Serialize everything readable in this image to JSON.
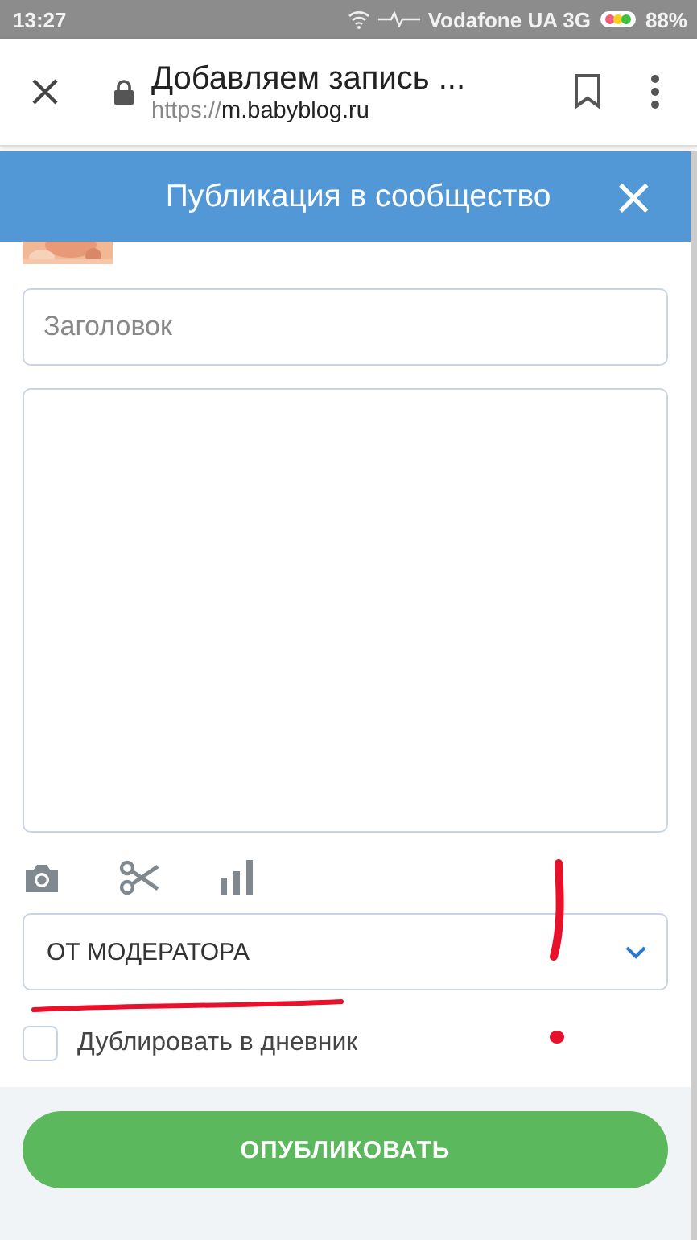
{
  "status_bar": {
    "time": "13:27",
    "carrier": "Vodafone UA 3G",
    "battery": "88%"
  },
  "browser": {
    "title": "Добавляем запись ...",
    "url_scheme": "https://",
    "url_host": "m.babyblog.ru"
  },
  "dialog": {
    "title": "Публикация в сообщество",
    "close": "×"
  },
  "form": {
    "title_placeholder": "Заголовок",
    "category": "ОТ МОДЕРАТОРА",
    "duplicate": {
      "label": "Дублировать в дневник",
      "checked": false
    },
    "submit": "ОПУБЛИКОВАТЬ"
  }
}
